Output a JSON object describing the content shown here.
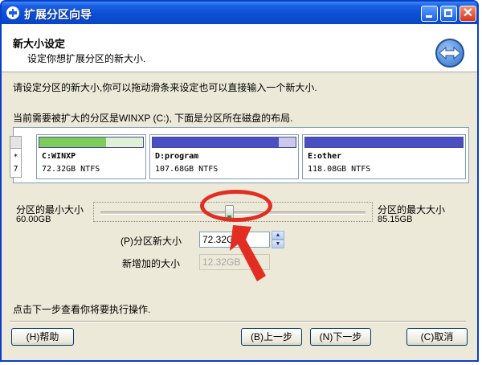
{
  "window": {
    "title": "扩展分区向导"
  },
  "header": {
    "title": "新大小设定",
    "subtitle": "设定你想扩展分区的新大小."
  },
  "instructions": {
    "line1": "请设定分区的新大小,你可以拖动滑条来设定也可以直接输入一个新大小.",
    "line2": "当前需要被扩大的分区是WINXP (C:), 下面是分区所在磁盘的布局."
  },
  "disk": {
    "legend_top": "*",
    "legend_bottom": "7",
    "partitions": [
      {
        "name": "C:WINXP",
        "info": "72.32GB NTFS",
        "fill_color": "#7ccd5a",
        "used_fraction": 0.64
      },
      {
        "name": "D:program",
        "info": "107.68GB NTFS",
        "fill_color": "#4a4ec4",
        "used_fraction": 0.88
      },
      {
        "name": "E:other",
        "info": "118.08GB NTFS",
        "fill_color": "#4a4ec4",
        "used_fraction": 1.0
      }
    ]
  },
  "slider": {
    "min_label": "分区的最小大小",
    "min_value": "60.00GB",
    "max_label": "分区的最大大小",
    "max_value": "85.15GB"
  },
  "new_size": {
    "label": "(P)分区新大小",
    "value": "72.32GB"
  },
  "added_size": {
    "label": "新增加的大小",
    "value": "12.32GB"
  },
  "footer_hint": "点击下一步查看你将要执行操作.",
  "buttons": {
    "help": "(H)帮助",
    "back": "(B)上一步",
    "next": "(N)下一步",
    "cancel": "(C)取消"
  },
  "colors": {
    "annotation": "#e22d22",
    "titlebar": "#0b4fd6"
  }
}
